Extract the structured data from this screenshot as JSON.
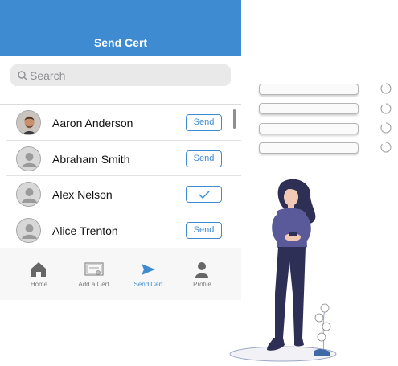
{
  "header": {
    "title": "Send Cert"
  },
  "search": {
    "placeholder": "Search"
  },
  "contacts": [
    {
      "name": "Aaron Anderson",
      "action": "Send",
      "sent": false,
      "photo": true
    },
    {
      "name": "Abraham Smith",
      "action": "Send",
      "sent": false,
      "photo": false
    },
    {
      "name": "Alex Nelson",
      "action": "",
      "sent": true,
      "photo": false
    },
    {
      "name": "Alice Trenton",
      "action": "Send",
      "sent": false,
      "photo": false
    }
  ],
  "tabs": [
    {
      "label": "Home",
      "icon": "home-icon"
    },
    {
      "label": "Add a Cert",
      "icon": "certificate-icon"
    },
    {
      "label": "Send Cert",
      "icon": "send-icon",
      "active": true
    },
    {
      "label": "Profile",
      "icon": "profile-icon"
    }
  ],
  "colors": {
    "accent": "#3f8bd2",
    "header": "#3f8bd2",
    "tabbar": "#f7f7f7",
    "figure_top": "#5a5a9a",
    "figure_pants": "#2e2f55"
  }
}
